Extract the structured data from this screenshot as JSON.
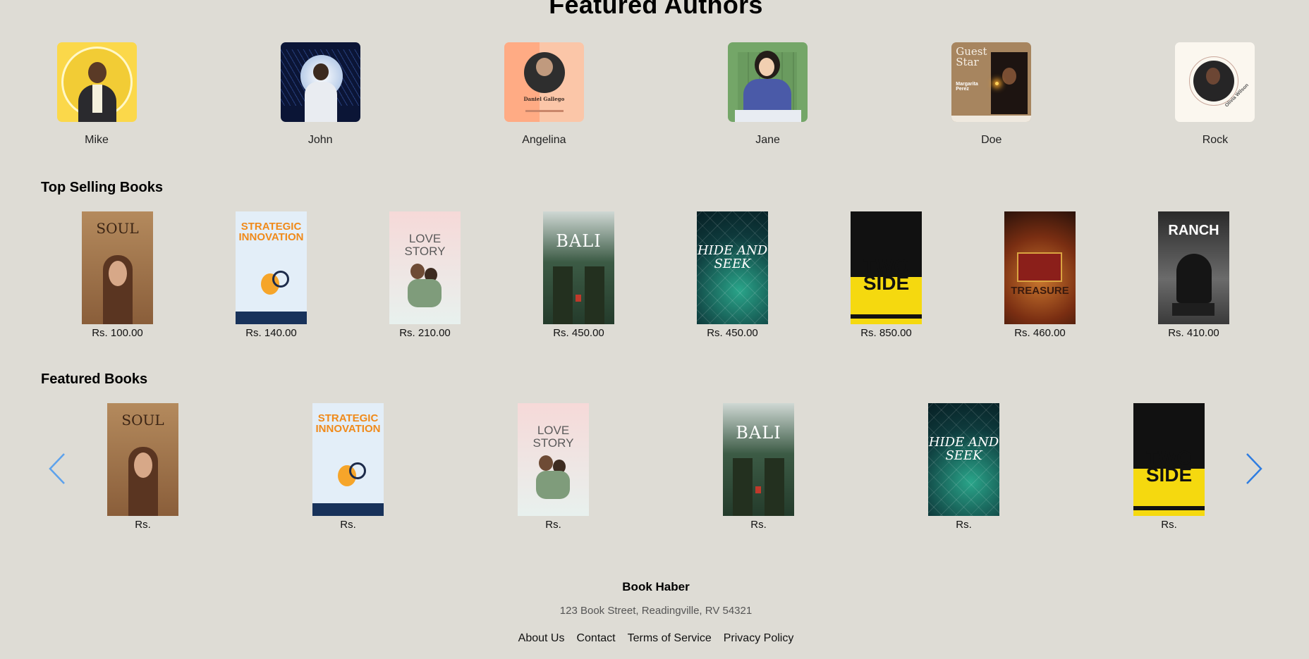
{
  "page_title": "Featured Authors",
  "authors": [
    {
      "name": "Mike"
    },
    {
      "name": "John"
    },
    {
      "name": "Angelina",
      "card_name": "Daniel Gallego"
    },
    {
      "name": "Jane"
    },
    {
      "name": "Doe",
      "card_title": "Guest Star",
      "card_name": "Margarita Perez"
    },
    {
      "name": "Rock",
      "card_name": "Olivia Wilson"
    }
  ],
  "top_selling": {
    "heading": "Top Selling Books",
    "books": [
      {
        "title": "SOUL",
        "price": "Rs. 100.00"
      },
      {
        "title": "STRATEGIC INNOVATION",
        "price": "Rs. 140.00"
      },
      {
        "title": "LOVE STORY",
        "price": "Rs. 210.00"
      },
      {
        "title": "BALI",
        "price": "Rs. 450.00"
      },
      {
        "title": "HIDE AND SEEK",
        "price": "Rs. 450.00"
      },
      {
        "title": "TWO SIDE",
        "price": "Rs. 850.00"
      },
      {
        "title": "TREASURE",
        "price": "Rs. 460.00"
      },
      {
        "title": "RANCH",
        "price": "Rs. 410.00"
      }
    ]
  },
  "featured": {
    "heading": "Featured Books",
    "books": [
      {
        "title": "SOUL",
        "price": "Rs."
      },
      {
        "title": "STRATEGIC INNOVATION",
        "price": "Rs."
      },
      {
        "title": "LOVE STORY",
        "price": "Rs."
      },
      {
        "title": "BALI",
        "price": "Rs."
      },
      {
        "title": "HIDE AND SEEK",
        "price": "Rs."
      },
      {
        "title": "TWO SIDE",
        "price": "Rs."
      }
    ]
  },
  "footer": {
    "brand": "Book Haber",
    "address": "123 Book Street, Readingville, RV 54321",
    "links": [
      "About Us",
      "Contact",
      "Terms of Service",
      "Privacy Policy"
    ]
  },
  "colors": {
    "background": "#dedcd5",
    "arrow": "#2f7de1"
  }
}
